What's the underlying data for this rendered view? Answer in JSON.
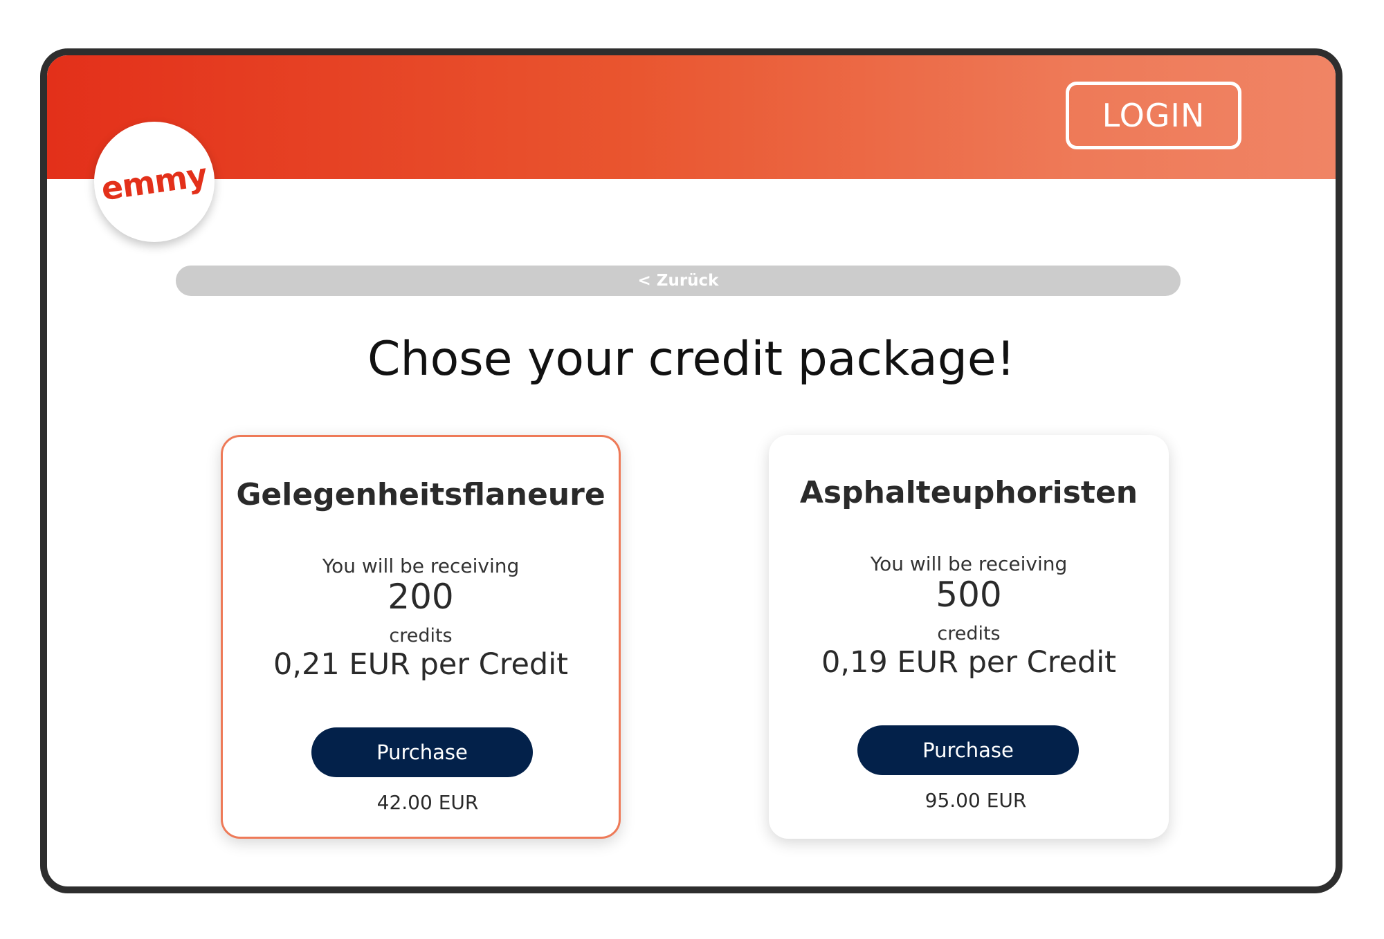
{
  "header": {
    "logo_text": "emmy",
    "login_label": "LOGIN"
  },
  "nav": {
    "back_label": "< Zurück"
  },
  "page": {
    "title": "Chose your credit package!"
  },
  "packages": [
    {
      "name": "Gelegenheitsflaneure",
      "receiving_text": "You will be receiving",
      "credits": "200",
      "credits_label": "credits",
      "per_credit": "0,21 EUR per Credit",
      "purchase_label": "Purchase",
      "price": "42.00 EUR",
      "selected": true
    },
    {
      "name": "Asphalteuphoristen",
      "receiving_text": "You will be receiving",
      "credits": "500",
      "credits_label": "credits",
      "per_credit": "0,19 EUR per Credit",
      "purchase_label": "Purchase",
      "price": "95.00 EUR",
      "selected": false
    }
  ],
  "colors": {
    "brand_red": "#e3301a",
    "brand_orange_light": "#f08465",
    "button_navy": "#03214a",
    "back_bar_gray": "#cccccc",
    "selected_border": "#ee7a58"
  }
}
